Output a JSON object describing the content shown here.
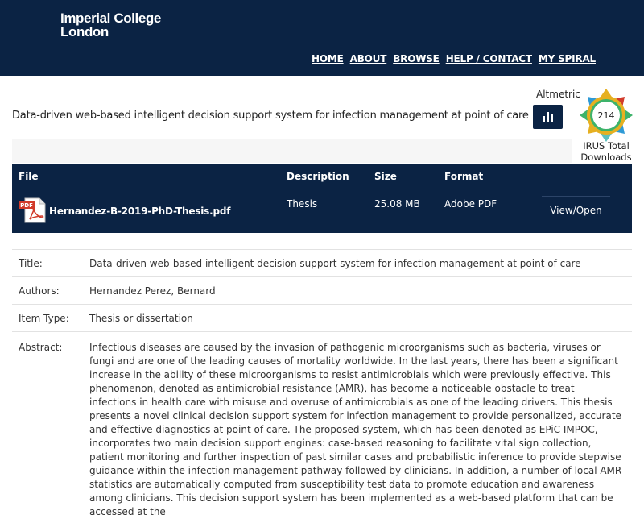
{
  "header": {
    "logo_line1": "Imperial College",
    "logo_line2": "London",
    "nav": [
      "HOME",
      "ABOUT",
      "BROWSE",
      "HELP / CONTACT",
      "MY SPIRAL"
    ]
  },
  "item": {
    "title": "Data-driven web-based intelligent decision support system for infection management at point of care",
    "altmetric_label": "Altmetric",
    "irus_count": "214",
    "irus_label_line1": "IRUS Total",
    "irus_label_line2": "Downloads"
  },
  "files": {
    "headers": [
      "File",
      "Description",
      "Size",
      "Format"
    ],
    "row": {
      "name": "Hernandez-B-2019-PhD-Thesis.pdf",
      "description": "Thesis",
      "size": "25.08 MB",
      "format": "Adobe PDF",
      "action": "View/Open",
      "icon": "pdf-icon"
    }
  },
  "metadata": {
    "title_label": "Title:",
    "title_value": "Data-driven web-based intelligent decision support system for infection management at point of care",
    "authors_label": "Authors:",
    "authors_value": "Hernandez Perez, Bernard",
    "type_label": "Item Type:",
    "type_value": "Thesis or dissertation",
    "abstract_label": "Abstract:",
    "abstract_value": "Infectious diseases are caused by the invasion of pathogenic microorganisms such as bacteria, viruses or fungi and are one of the leading causes of mortality worldwide. In the last years, there has been a significant increase in the ability of these microorganisms to resist antimicrobials which were previously effective. This phenomenon, denoted as antimicrobial resistance (AMR), has become a noticeable obstacle to treat infections in health care with misuse and overuse of antimicrobials as one of the leading drivers.   This thesis presents a novel clinical decision support system for infection management to provide personalized, accurate and effective diagnostics at point of care. The proposed system, which has been denoted as EPiC IMPOC, incorporates two main decision support engines: case-based reasoning to facilitate vital sign collection, patient monitoring and further inspection of past similar cases and probabilistic inference to provide stepwise guidance within the infection management pathway followed by clinicians. In addition, a number of local AMR statistics are automatically computed from susceptibility test data to promote education and awareness among clinicians. This decision support system has been implemented as a web-based platform that can be accessed at the"
  },
  "colors": {
    "header_bg": "#0b2344",
    "badge_colors": [
      "#2e9ad6",
      "#e6b021",
      "#d23b2b",
      "#3db36a",
      "#5bc0be"
    ]
  }
}
